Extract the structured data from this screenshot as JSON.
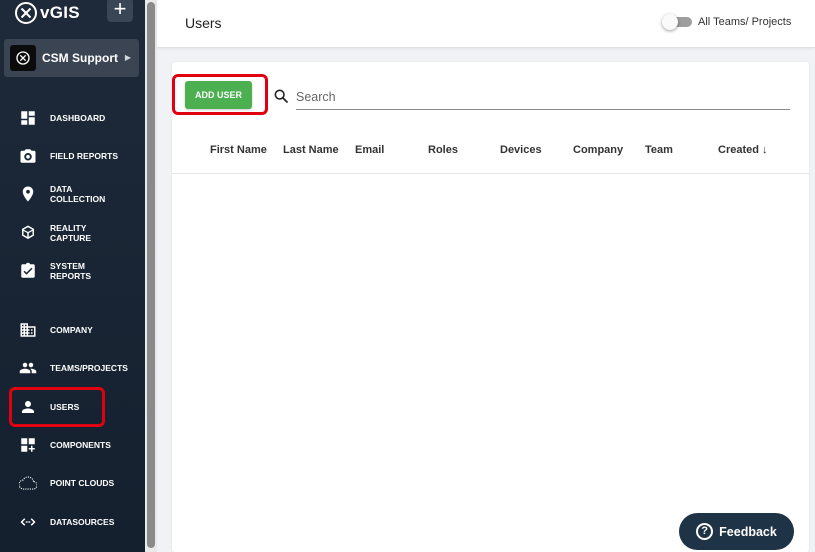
{
  "app": {
    "logo_text": "vGIS"
  },
  "org": {
    "name": "CSM Support"
  },
  "sidebar": {
    "items": [
      {
        "label_1": "DASHBOARD",
        "label_2": ""
      },
      {
        "label_1": "FIELD REPORTS",
        "label_2": ""
      },
      {
        "label_1": "DATA",
        "label_2": "COLLECTION"
      },
      {
        "label_1": "REALITY",
        "label_2": "CAPTURE"
      },
      {
        "label_1": "SYSTEM",
        "label_2": "REPORTS"
      },
      {
        "label_1": "COMPANY",
        "label_2": ""
      },
      {
        "label_1": "TEAMS/PROJECTS",
        "label_2": ""
      },
      {
        "label_1": "USERS",
        "label_2": ""
      },
      {
        "label_1": "COMPONENTS",
        "label_2": ""
      },
      {
        "label_1": "POINT CLOUDS",
        "label_2": ""
      },
      {
        "label_1": "DATASOURCES",
        "label_2": ""
      }
    ],
    "active": "USERS"
  },
  "header": {
    "title": "Users",
    "toggle_label": "All Teams/ Projects",
    "toggle_on": false
  },
  "toolbar": {
    "add_user_label": "ADD USER",
    "search_placeholder": "Search"
  },
  "table": {
    "columns": [
      "First Name",
      "Last Name",
      "Email",
      "Roles",
      "Devices",
      "Company",
      "Team",
      "Created"
    ],
    "sort_column": "Created",
    "sort_direction": "desc",
    "rows": []
  },
  "feedback": {
    "label": "Feedback"
  },
  "colors": {
    "sidebar_bg": "#1e2a3a",
    "accent_green": "#4caf50",
    "highlight_red": "#e00010",
    "feedback_bg": "#1f3346"
  }
}
